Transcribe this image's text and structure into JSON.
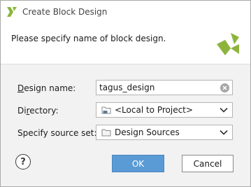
{
  "window": {
    "title": "Create Block Design"
  },
  "header": {
    "message": "Please specify name of block design."
  },
  "form": {
    "design_name": {
      "label_mnemonic": "D",
      "label_rest": "esign name:",
      "value": "tagus_design"
    },
    "directory": {
      "label_pre": "Di",
      "label_mnemonic": "r",
      "label_rest": "ectory:",
      "value": "<Local to Project>"
    },
    "source_set": {
      "label": "Specify source set:",
      "value": "Design Sources"
    }
  },
  "buttons": {
    "help": "?",
    "ok": "OK",
    "cancel": "Cancel"
  },
  "colors": {
    "logo_green": "#8cb43c",
    "ok_blue": "#5b9bd5",
    "folder_blue": "#5b7a99"
  },
  "icons": {
    "title_logo": "xilinx-logo-icon",
    "header_logo": "xilinx-logo-icon",
    "clear": "clear-icon",
    "directory": "local-folder-icon",
    "source_set": "folder-icon",
    "dropdown": "chevron-down-icon",
    "help": "help-icon"
  }
}
